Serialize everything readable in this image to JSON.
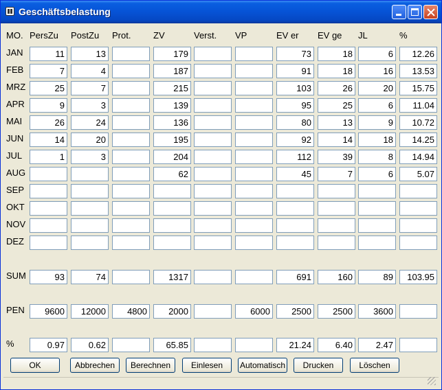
{
  "window": {
    "title": "Geschäftsbelastung"
  },
  "headers": [
    "MO.",
    "PersZu",
    "PostZu",
    "Prot.",
    "ZV",
    "Verst.",
    "VP",
    "EV er",
    "EV ge",
    "JL",
    "%"
  ],
  "rows": [
    {
      "label": "JAN",
      "values": [
        "11",
        "13",
        "",
        "179",
        "",
        "",
        "73",
        "18",
        "6",
        "12.26"
      ]
    },
    {
      "label": "FEB",
      "values": [
        "7",
        "4",
        "",
        "187",
        "",
        "",
        "91",
        "18",
        "16",
        "13.53"
      ]
    },
    {
      "label": "MRZ",
      "values": [
        "25",
        "7",
        "",
        "215",
        "",
        "",
        "103",
        "26",
        "20",
        "15.75"
      ]
    },
    {
      "label": "APR",
      "values": [
        "9",
        "3",
        "",
        "139",
        "",
        "",
        "95",
        "25",
        "6",
        "11.04"
      ]
    },
    {
      "label": "MAI",
      "values": [
        "26",
        "24",
        "",
        "136",
        "",
        "",
        "80",
        "13",
        "9",
        "10.72"
      ]
    },
    {
      "label": "JUN",
      "values": [
        "14",
        "20",
        "",
        "195",
        "",
        "",
        "92",
        "14",
        "18",
        "14.25"
      ]
    },
    {
      "label": "JUL",
      "values": [
        "1",
        "3",
        "",
        "204",
        "",
        "",
        "112",
        "39",
        "8",
        "14.94"
      ]
    },
    {
      "label": "AUG",
      "values": [
        "",
        "",
        "",
        "62",
        "",
        "",
        "45",
        "7",
        "6",
        "5.07"
      ]
    },
    {
      "label": "SEP",
      "values": [
        "",
        "",
        "",
        "",
        "",
        "",
        "",
        "",
        "",
        ""
      ]
    },
    {
      "label": "OKT",
      "values": [
        "",
        "",
        "",
        "",
        "",
        "",
        "",
        "",
        "",
        ""
      ]
    },
    {
      "label": "NOV",
      "values": [
        "",
        "",
        "",
        "",
        "",
        "",
        "",
        "",
        "",
        ""
      ]
    },
    {
      "label": "DEZ",
      "values": [
        "",
        "",
        "",
        "",
        "",
        "",
        "",
        "",
        "",
        ""
      ]
    }
  ],
  "summary_rows": [
    {
      "label": "SUM",
      "values": [
        "93",
        "74",
        "",
        "1317",
        "",
        "",
        "691",
        "160",
        "89",
        "103.95"
      ]
    },
    {
      "label": "PEN",
      "values": [
        "9600",
        "12000",
        "4800",
        "2000",
        "",
        "6000",
        "2500",
        "2500",
        "3600",
        ""
      ]
    },
    {
      "label": "%",
      "values": [
        "0.97",
        "0.62",
        "",
        "65.85",
        "",
        "",
        "21.24",
        "6.40",
        "2.47",
        ""
      ]
    }
  ],
  "buttons": [
    "OK",
    "Abbrechen",
    "Berechnen",
    "Einlesen",
    "Automatisch",
    "Drucken",
    "Löschen"
  ],
  "colors": {
    "titlebar": "#0a5ee0",
    "window_bg": "#ece9d8",
    "field_border": "#7f9db9"
  },
  "icons": [
    "app-icon",
    "minimize-icon",
    "maximize-icon",
    "close-icon",
    "resize-grip-icon"
  ]
}
